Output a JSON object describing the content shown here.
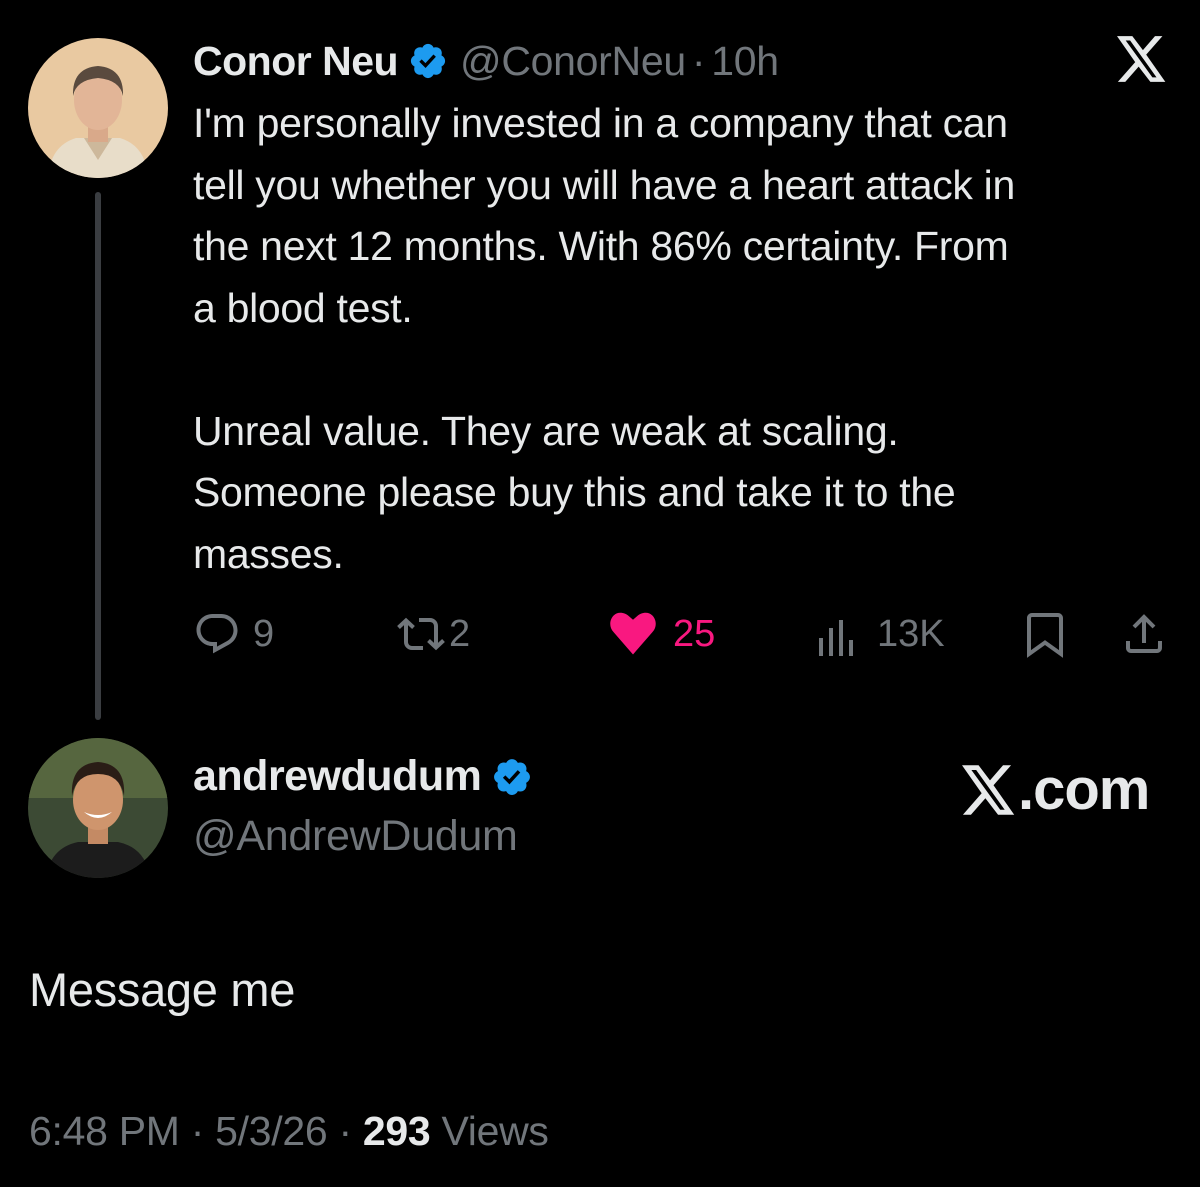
{
  "quoted_tweet": {
    "author": {
      "display_name": "Conor Neu",
      "handle": "@ConorNeu",
      "separator": "·",
      "time_ago": "10h",
      "verified": true
    },
    "text_lines_1": [
      "I'm personally invested in a company that can",
      "tell you whether you will have a heart attack in",
      "the next 12 months. With 86% certainty. From",
      "a blood test."
    ],
    "text_lines_2": [
      "Unreal value. They are weak at scaling.",
      "Someone please buy this and take it to the",
      "masses."
    ],
    "stats": {
      "replies": "9",
      "reposts": "2",
      "likes": "25",
      "views": "13K"
    }
  },
  "reply": {
    "display_name": "andrewdudum",
    "handle": "@AndrewDudum",
    "verified": true,
    "text": "Message me",
    "timestamp": "6:48 PM",
    "date": "5/3/26",
    "separator": "·",
    "views_count": "293",
    "views_label": "Views"
  },
  "brand": {
    "watermark_suffix": ".com"
  },
  "colors": {
    "background": "#000000",
    "text_primary": "#e7e9ea",
    "text_secondary": "#71767b",
    "verified_blue": "#1d9bf0",
    "like_pink": "#f91880"
  },
  "icons": [
    "x-logo-icon",
    "verified-badge-icon",
    "reply-icon",
    "repost-icon",
    "like-icon",
    "views-icon",
    "bookmark-icon",
    "share-icon"
  ]
}
